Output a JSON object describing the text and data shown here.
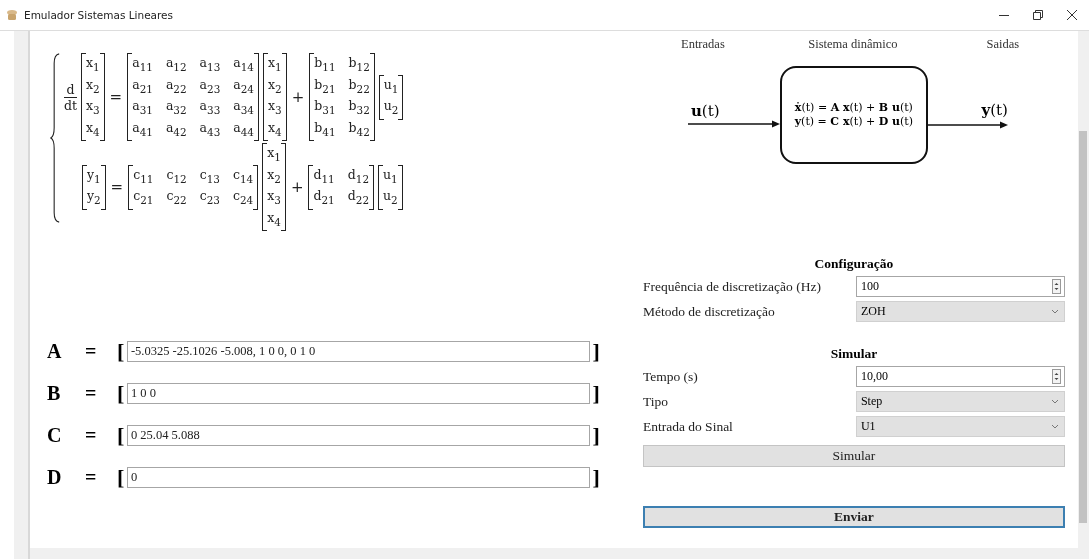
{
  "window": {
    "title": "Emulador Sistemas Lineares"
  },
  "equations": [
    {
      "tokens": [
        {
          "kind": "frac",
          "num": "d",
          "den": "dt"
        },
        {
          "kind": "matrix",
          "rows": [
            [
              "x$_{1}$"
            ],
            [
              "x$_{2}$"
            ],
            [
              "x$_{3}$"
            ],
            [
              "x$_{4}$"
            ]
          ]
        },
        {
          "kind": "op",
          "text": "="
        },
        {
          "kind": "matrix",
          "rows": [
            [
              "a$_{11}$",
              "a$_{12}$",
              "a$_{13}$",
              "a$_{14}$"
            ],
            [
              "a$_{21}$",
              "a$_{22}$",
              "a$_{23}$",
              "a$_{24}$"
            ],
            [
              "a$_{31}$",
              "a$_{32}$",
              "a$_{33}$",
              "a$_{34}$"
            ],
            [
              "a$_{41}$",
              "a$_{42}$",
              "a$_{43}$",
              "a$_{44}$"
            ]
          ]
        },
        {
          "kind": "matrix",
          "rows": [
            [
              "x$_{1}$"
            ],
            [
              "x$_{2}$"
            ],
            [
              "x$_{3}$"
            ],
            [
              "x$_{4}$"
            ]
          ]
        },
        {
          "kind": "op",
          "text": "+"
        },
        {
          "kind": "matrix",
          "rows": [
            [
              "b$_{11}$",
              "b$_{12}$"
            ],
            [
              "b$_{21}$",
              "b$_{22}$"
            ],
            [
              "b$_{31}$",
              "b$_{32}$"
            ],
            [
              "b$_{41}$",
              "b$_{42}$"
            ]
          ]
        },
        {
          "kind": "matrix",
          "rows": [
            [
              "u$_{1}$"
            ],
            [
              "u$_{2}$"
            ]
          ]
        }
      ]
    },
    {
      "tokens": [
        {
          "kind": "matrix",
          "rows": [
            [
              "y$_{1}$"
            ],
            [
              "y$_{2}$"
            ]
          ]
        },
        {
          "kind": "op",
          "text": "="
        },
        {
          "kind": "matrix",
          "rows": [
            [
              "c$_{11}$",
              "c$_{12}$",
              "c$_{13}$",
              "c$_{14}$"
            ],
            [
              "c$_{21}$",
              "c$_{22}$",
              "c$_{23}$",
              "c$_{24}$"
            ]
          ]
        },
        {
          "kind": "matrix",
          "rows": [
            [
              "x$_{1}$"
            ],
            [
              "x$_{2}$"
            ],
            [
              "x$_{3}$"
            ],
            [
              "x$_{4}$"
            ]
          ]
        },
        {
          "kind": "op",
          "text": "+"
        },
        {
          "kind": "matrix",
          "rows": [
            [
              "d$_{11}$",
              "d$_{12}$"
            ],
            [
              "d$_{21}$",
              "d$_{22}$"
            ]
          ]
        },
        {
          "kind": "matrix",
          "rows": [
            [
              "u$_{1}$"
            ],
            [
              "u$_{2}$"
            ]
          ]
        }
      ]
    }
  ],
  "matrices": [
    {
      "label": "A",
      "equals": "=",
      "open": "[",
      "value": "-5.0325 -25.1026 -5.008, 1 0 0, 0 1 0",
      "close": "]"
    },
    {
      "label": "B",
      "equals": "=",
      "open": "[",
      "value": "1 0 0",
      "close": "]"
    },
    {
      "label": "C",
      "equals": "=",
      "open": "[",
      "value": "0 25.04 5.088",
      "close": "]"
    },
    {
      "label": "D",
      "equals": "=",
      "open": "[",
      "value": "0",
      "close": "]"
    }
  ],
  "diagram": {
    "headings": [
      "Entradas",
      "Sistema dinâmico",
      "Saidas"
    ],
    "input": "**u**(t)",
    "system": [
      "**ẋ**(t) = **A x**(t) + **B u**(t)",
      "**y**(t) = **C x**(t) + **D u**(t)"
    ],
    "output": "**y**(t)"
  },
  "sections": [
    {
      "title": "Configuração",
      "fields": [
        {
          "kind": "spin",
          "label": "Frequência de discretização (Hz)",
          "value": "100"
        },
        {
          "kind": "select",
          "label": "Método de discretização",
          "value": "ZOH"
        }
      ]
    },
    {
      "title": "Simular",
      "fields": [
        {
          "kind": "spin",
          "label": "Tempo (s)",
          "value": "10,00"
        },
        {
          "kind": "select",
          "label": "Tipo",
          "value": "Step"
        },
        {
          "kind": "select",
          "label": "Entrada do Sinal",
          "value": "U1"
        }
      ],
      "button": "Simular"
    }
  ],
  "submit_button": "Enviar"
}
